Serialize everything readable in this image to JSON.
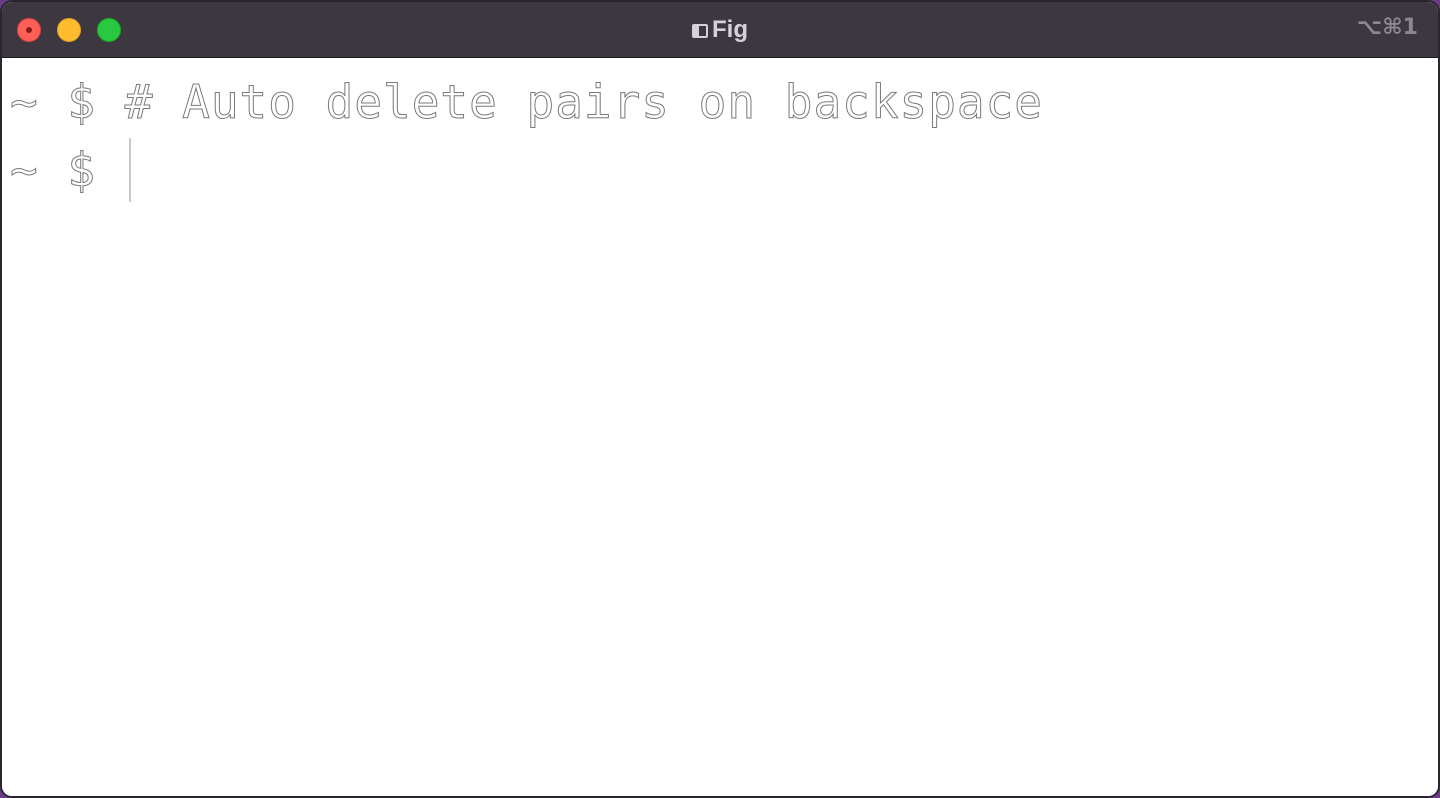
{
  "window": {
    "title": "Fig",
    "shortcut": "⌥⌘1"
  },
  "terminal": {
    "lines": [
      {
        "prompt": "~ $ ",
        "command": "# Auto delete pairs on backspace"
      },
      {
        "prompt": "~ $ ",
        "command": ""
      }
    ]
  },
  "colors": {
    "titlebar": "#3d3740",
    "close": "#fe5f57",
    "minimize": "#febc2e",
    "maximize": "#28c840"
  }
}
